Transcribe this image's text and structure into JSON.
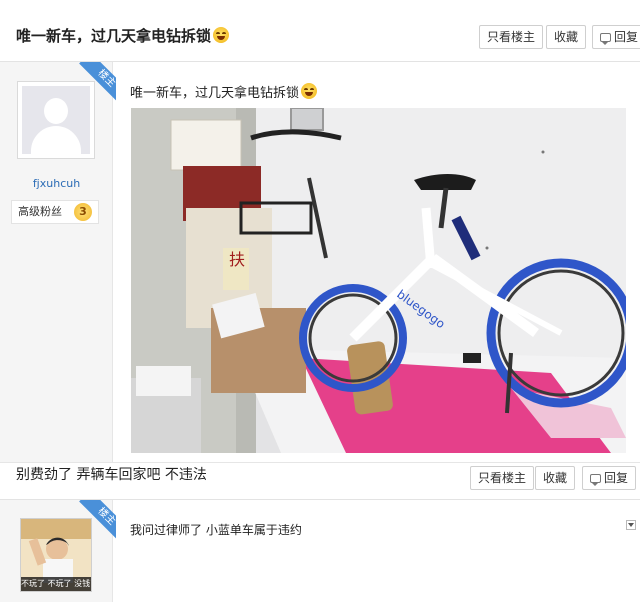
{
  "thread": {
    "title": "唯一新车，过几天拿电钻拆锁",
    "emoji_icon": "laughing-emoji-icon"
  },
  "actions": {
    "only_op": "只看楼主",
    "favorite": "收藏",
    "reply": "回复"
  },
  "post1": {
    "badge": "楼主",
    "username": "fjxuhcuh",
    "fan_title": "高级粉丝",
    "fan_level": "3",
    "text": "唯一新车，过几天拿电钻拆锁",
    "photo": {
      "bike_brand": "bluegogo",
      "poster_text": "扶",
      "accent_color": "#2f56c9"
    }
  },
  "post2": {
    "text": "别费劲了 弄辆车回家吧 不违法"
  },
  "post3": {
    "badge": "楼主",
    "avatar_caption": "不玩了 不玩了 没钱了",
    "text": "我问过律师了 小蓝单车属于违约"
  },
  "colors": {
    "owner_badge": "#4a90d9",
    "username": "#2a6bb5"
  }
}
